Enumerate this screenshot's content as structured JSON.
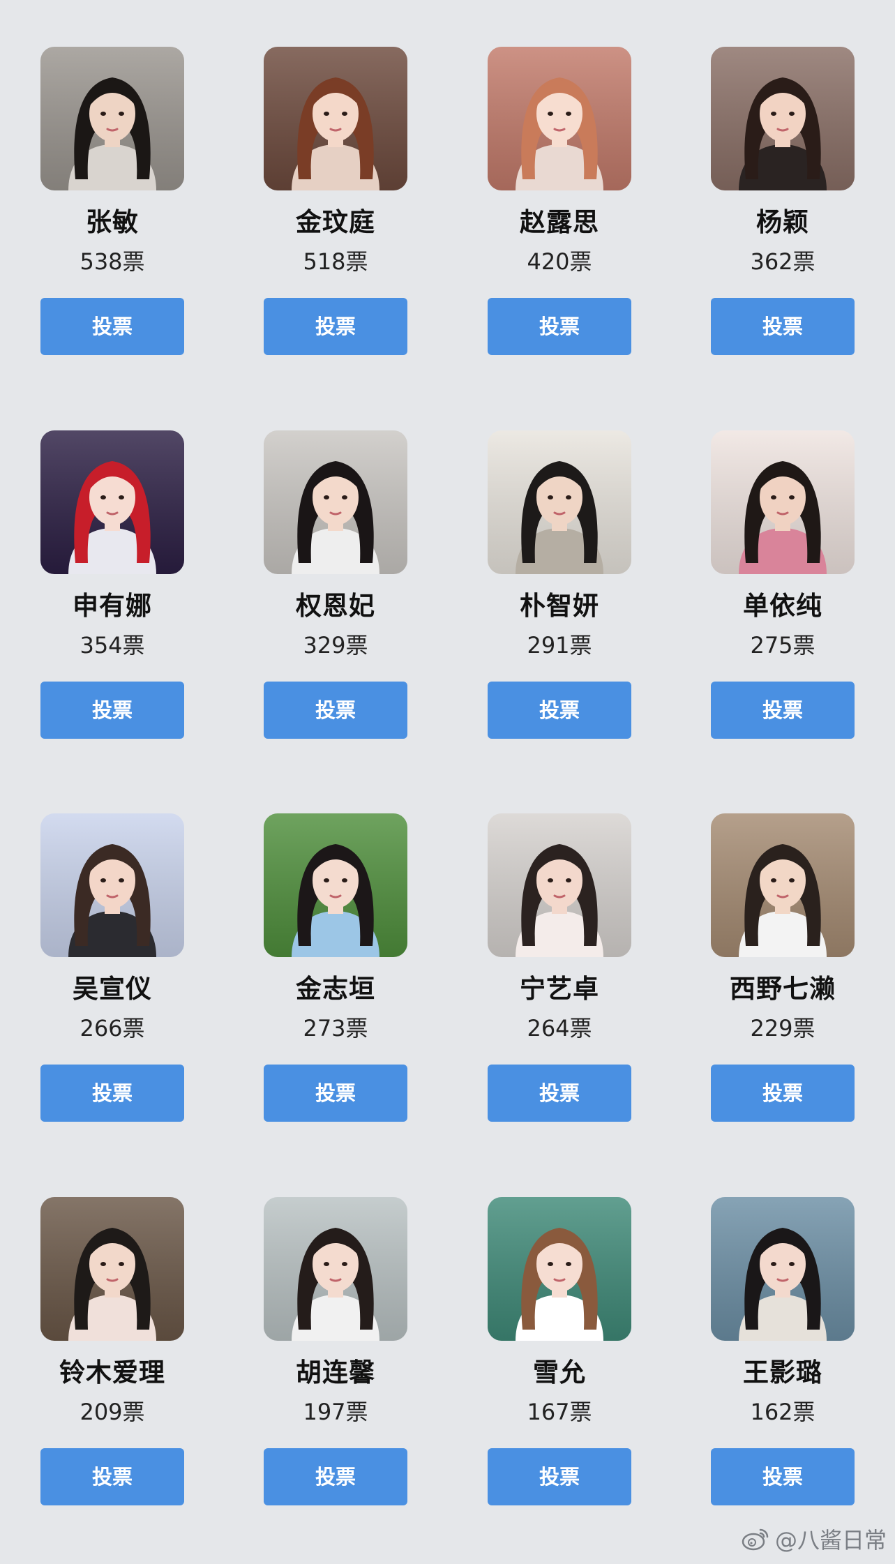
{
  "vote_button_label": "投票",
  "accent_color": "#4a90e2",
  "candidates": [
    {
      "name": "张敏",
      "votes": "538票",
      "bg": "#9a958f",
      "hair": "#1b1715",
      "skin": "#eed4c4",
      "cloth": "#d9d4cf"
    },
    {
      "name": "金玟庭",
      "votes": "518票",
      "bg": "#6d4a3d",
      "hair": "#7a3d26",
      "skin": "#f4d8c9",
      "cloth": "#e6d0c4"
    },
    {
      "name": "赵露思",
      "votes": "420票",
      "bg": "#c27a6a",
      "hair": "#c97b5a",
      "skin": "#f7ddd0",
      "cloth": "#e9d9d2"
    },
    {
      "name": "杨颖",
      "votes": "362票",
      "bg": "#8a6f66",
      "hair": "#2a1c18",
      "skin": "#f2d3c3",
      "cloth": "#2a2322"
    },
    {
      "name": "申有娜",
      "votes": "354票",
      "bg": "#2c1f44",
      "hair": "#c71e2a",
      "skin": "#f6dcd2",
      "cloth": "#e8e8ef"
    },
    {
      "name": "权恩妃",
      "votes": "329票",
      "bg": "#c9c6c2",
      "hair": "#1a1516",
      "skin": "#f3d9cb",
      "cloth": "#eeeeee"
    },
    {
      "name": "朴智妍",
      "votes": "291票",
      "bg": "#e8e4dd",
      "hair": "#1d1a19",
      "skin": "#efd5c5",
      "cloth": "#b5aea3"
    },
    {
      "name": "单依纯",
      "votes": "275票",
      "bg": "#efe4e0",
      "hair": "#1f1816",
      "skin": "#f0d2c2",
      "cloth": "#d9849a"
    },
    {
      "name": "吴宣仪",
      "votes": "266票",
      "bg": "#c9d3ec",
      "hair": "#3b2a24",
      "skin": "#f3d6c8",
      "cloth": "#2b2b30"
    },
    {
      "name": "金志垣",
      "votes": "273票",
      "bg": "#4f8f3c",
      "hair": "#1c1718",
      "skin": "#f4dbcf",
      "cloth": "#9cc6e6"
    },
    {
      "name": "宁艺卓",
      "votes": "264票",
      "bg": "#d6d2cf",
      "hair": "#2b2220",
      "skin": "#f3d8cc",
      "cloth": "#f4ecea"
    },
    {
      "name": "西野七濑",
      "votes": "229票",
      "bg": "#a58b72",
      "hair": "#2a211d",
      "skin": "#f2d7c6",
      "cloth": "#f3f3f3"
    },
    {
      "name": "铃木爱理",
      "votes": "209票",
      "bg": "#6a5747",
      "hair": "#1e1a18",
      "skin": "#f2d8ca",
      "cloth": "#f0e0da"
    },
    {
      "name": "胡连馨",
      "votes": "197票",
      "bg": "#b9c2c3",
      "hair": "#241c1a",
      "skin": "#f4dbcf",
      "cloth": "#f1f1f1"
    },
    {
      "name": "雪允",
      "votes": "167票",
      "bg": "#3f8a78",
      "hair": "#8a5a3d",
      "skin": "#f6ddd2",
      "cloth": "#ffffff"
    },
    {
      "name": "王影璐",
      "votes": "162票",
      "bg": "#6c8fa5",
      "hair": "#1a1718",
      "skin": "#f3d9cd",
      "cloth": "#e6e1da"
    }
  ],
  "watermark": {
    "logo_icon": "weibo-logo-icon",
    "text": "@八酱日常"
  }
}
